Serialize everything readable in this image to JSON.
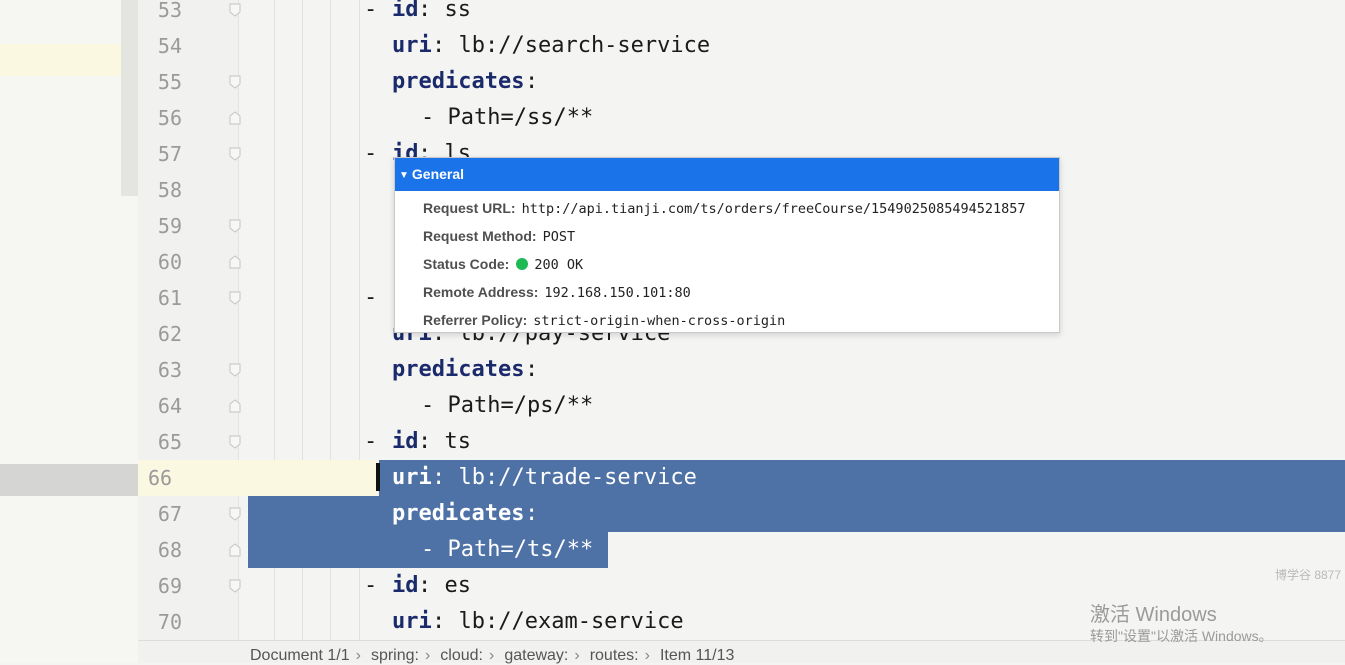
{
  "editor": {
    "line_numbers": [
      "53",
      "54",
      "55",
      "56",
      "57",
      "58",
      "59",
      "60",
      "61",
      "62",
      "63",
      "64",
      "65",
      "66",
      "67",
      "68",
      "69",
      "70"
    ],
    "lines": {
      "l53": {
        "dash": "- ",
        "key": "id",
        "rest": ": ss"
      },
      "l54": {
        "key": "uri",
        "rest": ": lb://search-service"
      },
      "l55": {
        "key": "predicates",
        "rest": ":"
      },
      "l56": {
        "text": "- Path=/ss/**"
      },
      "l57": {
        "dash": "- ",
        "key": "id",
        "rest": ": ls"
      },
      "l61": {
        "dash": "-"
      },
      "l62": {
        "key": "uri",
        "rest": ": lb://pay-service"
      },
      "l63": {
        "key": "predicates",
        "rest": ":"
      },
      "l64": {
        "text": "- Path=/ps/**"
      },
      "l65": {
        "dash": "- ",
        "key": "id",
        "rest": ": ts"
      },
      "l66": {
        "key": "uri",
        "rest": ": lb://trade-service"
      },
      "l67": {
        "key": "predicates",
        "rest": ":"
      },
      "l68": {
        "text": "- Path=/ts/**"
      },
      "l69": {
        "dash": "- ",
        "key": "id",
        "rest": ": es"
      },
      "l70": {
        "key": "uri",
        "rest": ": lb://exam-service"
      }
    },
    "selection_color": "#4f72a6",
    "key_color": "#1b2a6b"
  },
  "popup": {
    "header": "General",
    "rows": [
      {
        "label": "Request URL:",
        "value": "http://api.tianji.com/ts/orders/freeCourse/1549025085494521857"
      },
      {
        "label": "Request Method:",
        "value": "POST"
      },
      {
        "label": "Status Code:",
        "value": "200 OK",
        "status_color": "#1db954"
      },
      {
        "label": "Remote Address:",
        "value": "192.168.150.101:80"
      },
      {
        "label": "Referrer Policy:",
        "value": "strict-origin-when-cross-origin"
      }
    ],
    "header_color": "#1a73e8"
  },
  "breadcrumb": {
    "items": [
      "Document 1/1",
      "spring:",
      "cloud:",
      "gateway:",
      "routes:",
      "Item 11/13"
    ]
  },
  "watermark": {
    "small": "博学谷 8877",
    "title": "激活 Windows",
    "subtitle": "转到\"设置\"以激活 Windows。"
  }
}
